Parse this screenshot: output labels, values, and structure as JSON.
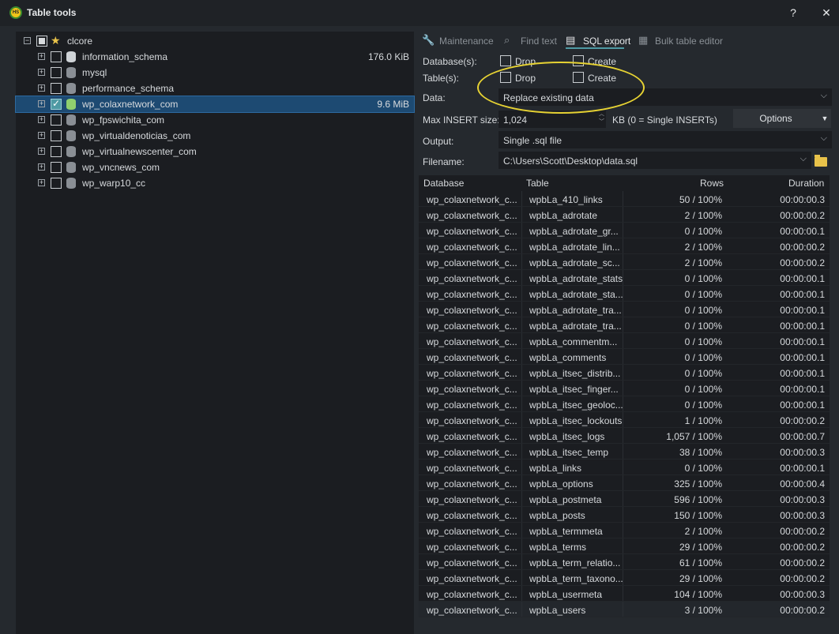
{
  "window": {
    "title": "Table tools",
    "app_icon_text": "HS",
    "help": "?",
    "close": "✕"
  },
  "tree": {
    "root": {
      "label": "clcore",
      "icon": "star-icon",
      "expander": "−"
    },
    "items": [
      {
        "label": "information_schema",
        "size": "176.0 KiB",
        "checked": false,
        "selected": false
      },
      {
        "label": "mysql",
        "size": "",
        "checked": false,
        "selected": false
      },
      {
        "label": "performance_schema",
        "size": "",
        "checked": false,
        "selected": false
      },
      {
        "label": "wp_colaxnetwork_com",
        "size": "9.6 MiB",
        "checked": true,
        "selected": true
      },
      {
        "label": "wp_fpswichita_com",
        "size": "",
        "checked": false,
        "selected": false
      },
      {
        "label": "wp_virtualdenoticias_com",
        "size": "",
        "checked": false,
        "selected": false
      },
      {
        "label": "wp_virtualnewscenter_com",
        "size": "",
        "checked": false,
        "selected": false
      },
      {
        "label": "wp_vncnews_com",
        "size": "",
        "checked": false,
        "selected": false
      },
      {
        "label": "wp_warp10_cc",
        "size": "",
        "checked": false,
        "selected": false
      }
    ],
    "expander_plus": "+"
  },
  "tabs": [
    {
      "label": "Maintenance",
      "icon": "wrench-icon",
      "glyph": "🔧",
      "active": false
    },
    {
      "label": "Find text",
      "icon": "binoculars-icon",
      "glyph": "⌕",
      "active": false
    },
    {
      "label": "SQL export",
      "icon": "export-icon",
      "glyph": "▤",
      "active": true
    },
    {
      "label": "Bulk table editor",
      "icon": "tables-icon",
      "glyph": "▦",
      "active": false
    }
  ],
  "options": {
    "databases_label": "Database(s):",
    "tables_label": "Table(s):",
    "drop": "Drop",
    "create": "Create",
    "data_label": "Data:",
    "data_value": "Replace existing data",
    "max_insert_label": "Max INSERT size:",
    "max_insert_value": "1,024",
    "max_insert_hint": "KB (0 = Single INSERTs)",
    "options_button": "Options",
    "output_label": "Output:",
    "output_value": "Single .sql file",
    "filename_label": "Filename:",
    "filename_value": "C:\\Users\\Scott\\Desktop\\data.sql"
  },
  "grid": {
    "headers": {
      "database": "Database",
      "table": "Table",
      "rows": "Rows",
      "duration": "Duration"
    },
    "rows": [
      {
        "database": "wp_colaxnetwork_c...",
        "table": "wpbLa_410_links",
        "rows": "50 / 100%",
        "duration": "00:00:00.3"
      },
      {
        "database": "wp_colaxnetwork_c...",
        "table": "wpbLa_adrotate",
        "rows": "2 / 100%",
        "duration": "00:00:00.2"
      },
      {
        "database": "wp_colaxnetwork_c...",
        "table": "wpbLa_adrotate_gr...",
        "rows": "0 / 100%",
        "duration": "00:00:00.1"
      },
      {
        "database": "wp_colaxnetwork_c...",
        "table": "wpbLa_adrotate_lin...",
        "rows": "2 / 100%",
        "duration": "00:00:00.2"
      },
      {
        "database": "wp_colaxnetwork_c...",
        "table": "wpbLa_adrotate_sc...",
        "rows": "2 / 100%",
        "duration": "00:00:00.2"
      },
      {
        "database": "wp_colaxnetwork_c...",
        "table": "wpbLa_adrotate_stats",
        "rows": "0 / 100%",
        "duration": "00:00:00.1"
      },
      {
        "database": "wp_colaxnetwork_c...",
        "table": "wpbLa_adrotate_sta...",
        "rows": "0 / 100%",
        "duration": "00:00:00.1"
      },
      {
        "database": "wp_colaxnetwork_c...",
        "table": "wpbLa_adrotate_tra...",
        "rows": "0 / 100%",
        "duration": "00:00:00.1"
      },
      {
        "database": "wp_colaxnetwork_c...",
        "table": "wpbLa_adrotate_tra...",
        "rows": "0 / 100%",
        "duration": "00:00:00.1"
      },
      {
        "database": "wp_colaxnetwork_c...",
        "table": "wpbLa_commentm...",
        "rows": "0 / 100%",
        "duration": "00:00:00.1"
      },
      {
        "database": "wp_colaxnetwork_c...",
        "table": "wpbLa_comments",
        "rows": "0 / 100%",
        "duration": "00:00:00.1"
      },
      {
        "database": "wp_colaxnetwork_c...",
        "table": "wpbLa_itsec_distrib...",
        "rows": "0 / 100%",
        "duration": "00:00:00.1"
      },
      {
        "database": "wp_colaxnetwork_c...",
        "table": "wpbLa_itsec_finger...",
        "rows": "0 / 100%",
        "duration": "00:00:00.1"
      },
      {
        "database": "wp_colaxnetwork_c...",
        "table": "wpbLa_itsec_geoloc...",
        "rows": "0 / 100%",
        "duration": "00:00:00.1"
      },
      {
        "database": "wp_colaxnetwork_c...",
        "table": "wpbLa_itsec_lockouts",
        "rows": "1 / 100%",
        "duration": "00:00:00.2"
      },
      {
        "database": "wp_colaxnetwork_c...",
        "table": "wpbLa_itsec_logs",
        "rows": "1,057 / 100%",
        "duration": "00:00:00.7"
      },
      {
        "database": "wp_colaxnetwork_c...",
        "table": "wpbLa_itsec_temp",
        "rows": "38 / 100%",
        "duration": "00:00:00.3"
      },
      {
        "database": "wp_colaxnetwork_c...",
        "table": "wpbLa_links",
        "rows": "0 / 100%",
        "duration": "00:00:00.1"
      },
      {
        "database": "wp_colaxnetwork_c...",
        "table": "wpbLa_options",
        "rows": "325 / 100%",
        "duration": "00:00:00.4"
      },
      {
        "database": "wp_colaxnetwork_c...",
        "table": "wpbLa_postmeta",
        "rows": "596 / 100%",
        "duration": "00:00:00.3"
      },
      {
        "database": "wp_colaxnetwork_c...",
        "table": "wpbLa_posts",
        "rows": "150 / 100%",
        "duration": "00:00:00.3"
      },
      {
        "database": "wp_colaxnetwork_c...",
        "table": "wpbLa_termmeta",
        "rows": "2 / 100%",
        "duration": "00:00:00.2"
      },
      {
        "database": "wp_colaxnetwork_c...",
        "table": "wpbLa_terms",
        "rows": "29 / 100%",
        "duration": "00:00:00.2"
      },
      {
        "database": "wp_colaxnetwork_c...",
        "table": "wpbLa_term_relatio...",
        "rows": "61 / 100%",
        "duration": "00:00:00.2"
      },
      {
        "database": "wp_colaxnetwork_c...",
        "table": "wpbLa_term_taxono...",
        "rows": "29 / 100%",
        "duration": "00:00:00.2"
      },
      {
        "database": "wp_colaxnetwork_c...",
        "table": "wpbLa_usermeta",
        "rows": "104 / 100%",
        "duration": "00:00:00.3"
      },
      {
        "database": "wp_colaxnetwork_c...",
        "table": "wpbLa_users",
        "rows": "3 / 100%",
        "duration": "00:00:00.2"
      }
    ]
  }
}
